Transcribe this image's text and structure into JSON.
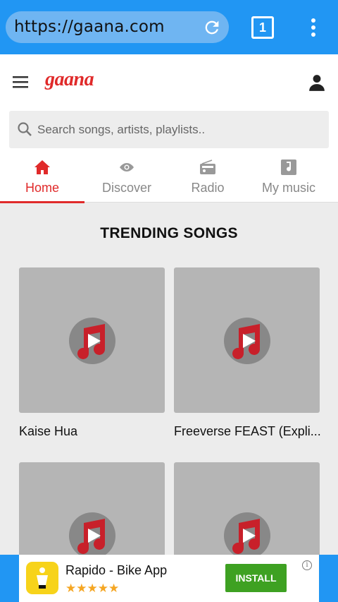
{
  "browser": {
    "url": "https://gaana.com",
    "tab_count": "1"
  },
  "app": {
    "brand": "gaana",
    "search_placeholder": "Search songs, artists, playlists..",
    "accent_color": "#e02a2a"
  },
  "tabs": [
    {
      "label": "Home",
      "icon": "home-icon",
      "active": true
    },
    {
      "label": "Discover",
      "icon": "eye-icon",
      "active": false
    },
    {
      "label": "Radio",
      "icon": "radio-icon",
      "active": false
    },
    {
      "label": "My music",
      "icon": "music-note-icon",
      "active": false
    }
  ],
  "section": {
    "title": "TRENDING SONGS",
    "songs": [
      {
        "title": "Kaise Hua"
      },
      {
        "title": "Freeverse FEAST (Expli..."
      },
      {
        "title": ""
      },
      {
        "title": ""
      }
    ]
  },
  "ad": {
    "title": "Rapido - Bike App",
    "stars": "★★★★★",
    "install_label": "INSTALL",
    "info": "i"
  }
}
